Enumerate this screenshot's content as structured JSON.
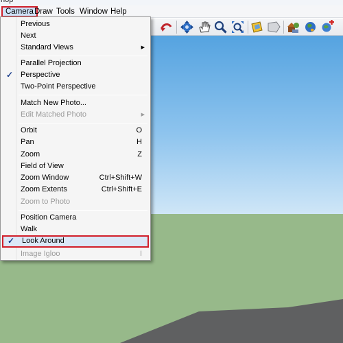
{
  "window": {
    "title_fragment": "hop"
  },
  "menubar": {
    "items": [
      {
        "label": "Camera",
        "active": true
      },
      {
        "label": "Draw"
      },
      {
        "label": "Tools"
      },
      {
        "label": "Window"
      },
      {
        "label": "Help"
      }
    ]
  },
  "toolbar": {
    "tools": [
      "undo-curve-icon",
      "orbit-icon",
      "pan-hand-icon",
      "zoom-magnifier-icon",
      "zoom-extents-icon",
      "get-models-icon",
      "share-model-icon",
      "3d-warehouse-icon",
      "google-earth-icon",
      "add-location-icon"
    ]
  },
  "camera_menu": {
    "previous": "Previous",
    "next": "Next",
    "standard_views": "Standard Views",
    "parallel_projection": "Parallel Projection",
    "perspective": "Perspective",
    "two_point_perspective": "Two-Point Perspective",
    "match_new_photo": "Match New Photo...",
    "edit_matched_photo": "Edit Matched Photo",
    "orbit": "Orbit",
    "orbit_shortcut": "O",
    "pan": "Pan",
    "pan_shortcut": "H",
    "zoom": "Zoom",
    "zoom_shortcut": "Z",
    "field_of_view": "Field of View",
    "zoom_window": "Zoom Window",
    "zoom_window_shortcut": "Ctrl+Shift+W",
    "zoom_extents": "Zoom Extents",
    "zoom_extents_shortcut": "Ctrl+Shift+E",
    "zoom_to_photo": "Zoom to Photo",
    "position_camera": "Position Camera",
    "walk": "Walk",
    "look_around": "Look Around",
    "image_igloo": "Image Igloo",
    "image_igloo_shortcut": "I",
    "check_mark": "✓",
    "submenu_arrow": "▶"
  },
  "colors": {
    "highlight_border": "#d11f2a",
    "sky_top": "#55a3e0",
    "ground": "#97b98a",
    "road": "#5f6061"
  }
}
